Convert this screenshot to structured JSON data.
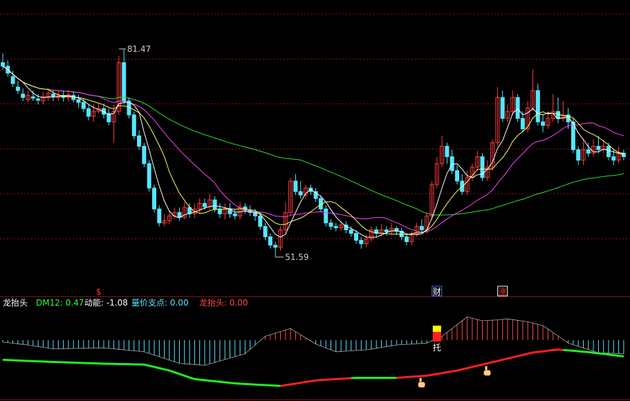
{
  "colors": {
    "background": "#000000",
    "grid": "#8b1a1a",
    "candle_up": "#ff3b3b",
    "candle_down": "#55e6ff",
    "ma5": "#ffffff",
    "ma10": "#ffff66",
    "ma20": "#ff44ff",
    "ma60": "#33dd33",
    "osc_up": "#ff4a4a",
    "osc_down": "#55e6ff",
    "line_rise": "#ff2020",
    "line_fall": "#22ee22",
    "legend_name": "#ffffff",
    "legend_dm": "#33ff33",
    "legend_energy": "#ffffff",
    "legend_support": "#55e6ff",
    "legend_dragon": "#ff4a4a"
  },
  "chart_data": [
    {
      "type": "candlestick",
      "ylim": [
        48,
        88
      ],
      "grid_values": [
        86.5,
        80.0,
        73.6,
        67.1,
        60.7,
        54.2
      ],
      "annotations": {
        "high": {
          "value": 81.47,
          "label": "81.47",
          "index": 23
        },
        "low": {
          "value": 51.59,
          "label": "51.59",
          "index": 54
        }
      },
      "markers": [
        {
          "index": 19,
          "text": "$",
          "color": "#ff3333"
        },
        {
          "index": 86,
          "text": "财",
          "color": "#ffffff",
          "box": "#4466ff"
        },
        {
          "index": 99,
          "text": "涨",
          "color": "#ff3333",
          "box": "#ffffff"
        }
      ],
      "ohlc": [
        [
          79.5,
          79.0,
          80.8,
          78.5
        ],
        [
          79.0,
          78.0,
          79.8,
          77.5
        ],
        [
          77.5,
          76.5,
          78.3,
          76.0
        ],
        [
          76.0,
          75.5,
          76.9,
          75.0
        ],
        [
          75.0,
          74.5,
          75.8,
          74.0
        ],
        [
          74.2,
          74.8,
          75.5,
          73.8
        ],
        [
          74.6,
          74.4,
          75.5,
          74.0
        ],
        [
          74.3,
          74.1,
          75.0,
          73.5
        ],
        [
          74.0,
          74.6,
          75.3,
          73.5
        ],
        [
          74.5,
          75.1,
          75.8,
          74.0
        ],
        [
          75.0,
          74.6,
          75.5,
          74.0
        ],
        [
          74.5,
          74.8,
          75.5,
          74.0
        ],
        [
          74.8,
          74.5,
          75.5,
          73.9
        ],
        [
          74.5,
          74.9,
          75.6,
          73.9
        ],
        [
          74.8,
          74.2,
          75.4,
          73.8
        ],
        [
          74.2,
          73.8,
          74.9,
          73.0
        ],
        [
          73.8,
          72.9,
          74.4,
          72.4
        ],
        [
          72.9,
          71.8,
          73.5,
          71.2
        ],
        [
          71.8,
          72.5,
          73.5,
          71.0
        ],
        [
          72.5,
          72.9,
          73.6,
          72.2
        ],
        [
          72.9,
          72.1,
          73.6,
          71.5
        ],
        [
          72.2,
          71.0,
          72.9,
          70.5
        ],
        [
          71.0,
          72.5,
          73.5,
          68.0
        ],
        [
          72.5,
          79.5,
          80.5,
          72.0
        ],
        [
          79.5,
          74.0,
          81.47,
          73.5
        ],
        [
          74.0,
          72.0,
          74.5,
          71.5
        ],
        [
          72.0,
          69.0,
          72.5,
          68.5
        ],
        [
          69.0,
          67.5,
          69.8,
          67.0
        ],
        [
          67.5,
          65.0,
          68.0,
          64.5
        ],
        [
          65.0,
          61.5,
          65.5,
          61.0
        ],
        [
          61.5,
          58.5,
          62.0,
          58.0
        ],
        [
          58.5,
          56.5,
          59.0,
          56.0
        ],
        [
          56.5,
          56.8,
          57.8,
          56.0
        ],
        [
          56.8,
          57.5,
          58.3,
          56.3
        ],
        [
          57.5,
          58.0,
          58.7,
          57.0
        ],
        [
          58.0,
          57.3,
          58.7,
          56.8
        ],
        [
          57.3,
          58.7,
          59.5,
          57.0
        ],
        [
          58.7,
          57.8,
          59.3,
          57.2
        ],
        [
          57.8,
          58.5,
          59.3,
          57.2
        ],
        [
          58.5,
          59.3,
          60.0,
          58.0
        ],
        [
          59.3,
          58.8,
          60.0,
          58.4
        ],
        [
          58.8,
          59.8,
          60.7,
          58.4
        ],
        [
          59.8,
          58.5,
          60.3,
          58.0
        ],
        [
          58.5,
          57.8,
          59.3,
          57.2
        ],
        [
          57.8,
          58.5,
          59.3,
          57.0
        ],
        [
          58.5,
          57.8,
          59.3,
          57.2
        ],
        [
          57.8,
          57.5,
          58.5,
          57.0
        ],
        [
          57.5,
          58.8,
          59.5,
          57.0
        ],
        [
          58.8,
          58.3,
          59.3,
          57.8
        ],
        [
          58.3,
          58.0,
          59.0,
          57.5
        ],
        [
          58.0,
          57.5,
          58.5,
          56.8
        ],
        [
          57.5,
          56.0,
          58.0,
          55.5
        ],
        [
          56.0,
          54.5,
          56.5,
          54.0
        ],
        [
          54.5,
          53.3,
          55.0,
          52.8
        ],
        [
          53.3,
          53.0,
          53.8,
          51.59
        ],
        [
          53.0,
          55.5,
          56.0,
          52.5
        ],
        [
          55.5,
          58.0,
          59.5,
          55.0
        ],
        [
          58.0,
          62.5,
          63.0,
          57.5
        ],
        [
          62.5,
          61.0,
          63.5,
          60.5
        ],
        [
          61.0,
          60.5,
          62.5,
          60.0
        ],
        [
          60.5,
          61.5,
          62.0,
          60.0
        ],
        [
          61.5,
          61.0,
          62.0,
          60.5
        ],
        [
          61.0,
          60.0,
          61.5,
          59.5
        ],
        [
          60.0,
          58.5,
          60.5,
          58.0
        ],
        [
          58.5,
          56.5,
          59.0,
          56.0
        ],
        [
          56.5,
          56.0,
          57.0,
          55.5
        ],
        [
          56.0,
          55.8,
          56.5,
          55.3
        ],
        [
          55.8,
          56.2,
          56.8,
          55.3
        ],
        [
          56.2,
          55.5,
          56.7,
          55.0
        ],
        [
          55.5,
          55.0,
          56.0,
          54.5
        ],
        [
          55.0,
          54.0,
          55.5,
          53.5
        ],
        [
          54.0,
          53.5,
          54.5,
          52.8
        ],
        [
          53.5,
          54.2,
          54.8,
          53.0
        ],
        [
          54.2,
          55.5,
          56.0,
          53.8
        ],
        [
          55.5,
          55.0,
          56.0,
          54.5
        ],
        [
          55.0,
          55.5,
          56.3,
          54.6
        ],
        [
          55.5,
          55.2,
          56.0,
          54.7
        ],
        [
          55.2,
          55.7,
          56.5,
          54.8
        ],
        [
          55.7,
          55.3,
          56.0,
          54.8
        ],
        [
          55.3,
          54.5,
          55.8,
          54.0
        ],
        [
          54.5,
          53.8,
          55.0,
          53.3
        ],
        [
          53.8,
          54.8,
          55.3,
          53.3
        ],
        [
          54.8,
          56.0,
          56.5,
          54.5
        ],
        [
          56.0,
          55.5,
          57.0,
          55.0
        ],
        [
          55.5,
          57.5,
          58.0,
          55.0
        ],
        [
          57.5,
          62.0,
          62.5,
          57.0
        ],
        [
          62.0,
          65.0,
          66.0,
          61.5
        ],
        [
          65.0,
          67.5,
          69.0,
          64.5
        ],
        [
          67.5,
          66.0,
          68.0,
          65.0
        ],
        [
          66.0,
          64.0,
          67.0,
          63.5
        ],
        [
          64.0,
          62.5,
          64.8,
          62.0
        ],
        [
          62.5,
          61.0,
          63.5,
          60.5
        ],
        [
          61.0,
          63.0,
          64.0,
          60.5
        ],
        [
          63.0,
          64.5,
          65.0,
          62.5
        ],
        [
          64.5,
          66.0,
          66.8,
          64.0
        ],
        [
          66.0,
          63.0,
          66.5,
          62.5
        ],
        [
          63.0,
          64.5,
          65.5,
          62.5
        ],
        [
          64.5,
          68.0,
          68.5,
          64.0
        ],
        [
          68.0,
          74.5,
          76.0,
          67.5
        ],
        [
          74.5,
          71.5,
          75.5,
          71.0
        ],
        [
          71.5,
          72.5,
          73.5,
          71.0
        ],
        [
          72.5,
          74.5,
          75.5,
          72.0
        ],
        [
          74.5,
          71.5,
          75.0,
          71.0
        ],
        [
          71.5,
          70.0,
          72.5,
          69.5
        ],
        [
          70.0,
          73.0,
          74.0,
          69.5
        ],
        [
          73.0,
          75.5,
          78.5,
          72.5
        ],
        [
          75.5,
          71.0,
          76.5,
          70.5
        ],
        [
          71.0,
          70.5,
          72.0,
          69.5
        ],
        [
          70.5,
          71.5,
          72.5,
          70.0
        ],
        [
          71.5,
          72.5,
          75.0,
          71.0
        ],
        [
          72.5,
          71.5,
          74.5,
          70.8
        ],
        [
          71.5,
          72.0,
          74.0,
          71.0
        ],
        [
          72.0,
          71.0,
          73.0,
          70.0
        ],
        [
          71.0,
          67.0,
          71.5,
          66.5
        ],
        [
          67.0,
          65.5,
          67.5,
          64.8
        ],
        [
          65.5,
          67.0,
          68.5,
          64.8
        ],
        [
          67.0,
          66.5,
          68.0,
          66.0
        ],
        [
          66.5,
          67.5,
          68.5,
          66.0
        ],
        [
          67.5,
          67.0,
          69.0,
          66.5
        ],
        [
          67.0,
          67.5,
          68.5,
          66.5
        ],
        [
          67.5,
          66.0,
          68.0,
          65.5
        ],
        [
          66.0,
          65.5,
          67.0,
          64.8
        ],
        [
          65.5,
          66.5,
          67.5,
          65.0
        ],
        [
          66.5,
          66.0,
          67.0,
          65.5
        ]
      ]
    },
    {
      "type": "indicator",
      "legend": {
        "name": "龙抬头",
        "dm12": "DM12: 0.47",
        "energy": "动能: -1.08",
        "support": "量价支点: 0.00",
        "dragon": "龙抬头: 0.00"
      },
      "badge_text": "托",
      "osc_ylim": [
        -4,
        3
      ],
      "line_ylim": [
        0,
        10
      ],
      "osc_keys": [
        [
          0,
          -0.2
        ],
        [
          5,
          -0.5
        ],
        [
          10,
          -0.9
        ],
        [
          20,
          -0.8
        ],
        [
          28,
          -1.2
        ],
        [
          35,
          -2.4
        ],
        [
          40,
          -2.6
        ],
        [
          48,
          -1.4
        ],
        [
          52,
          0.4
        ],
        [
          57,
          1.2
        ],
        [
          62,
          -0.4
        ],
        [
          66,
          -1.2
        ],
        [
          72,
          -1.0
        ],
        [
          78,
          -0.5
        ],
        [
          84,
          -0.3
        ],
        [
          87,
          0.4
        ],
        [
          92,
          2.4
        ],
        [
          95,
          2.0
        ],
        [
          98,
          2.1
        ],
        [
          100,
          2.2
        ],
        [
          104,
          1.9
        ],
        [
          107,
          1.5
        ],
        [
          112,
          -0.3
        ],
        [
          118,
          -1.3
        ],
        [
          123,
          -1.4
        ]
      ],
      "line_keys": [
        [
          0,
          8.8
        ],
        [
          10,
          8.3
        ],
        [
          20,
          7.9
        ],
        [
          28,
          7.7
        ],
        [
          33,
          6.3
        ],
        [
          38,
          4.3
        ],
        [
          46,
          3.3
        ],
        [
          55,
          2.7
        ],
        [
          62,
          4.0
        ],
        [
          70,
          4.6
        ],
        [
          78,
          4.6
        ],
        [
          84,
          5.1
        ],
        [
          90,
          6.3
        ],
        [
          95,
          7.7
        ],
        [
          100,
          9.1
        ],
        [
          105,
          10.5
        ],
        [
          110,
          11.2
        ],
        [
          116,
          10.6
        ],
        [
          123,
          9.6
        ]
      ],
      "line_colors": [
        [
          "green",
          0,
          54
        ],
        [
          "red",
          55,
          68
        ],
        [
          "green",
          69,
          77
        ],
        [
          "red",
          78,
          110
        ],
        [
          "green",
          111,
          123
        ]
      ],
      "pointers": [
        82,
        95
      ]
    }
  ]
}
